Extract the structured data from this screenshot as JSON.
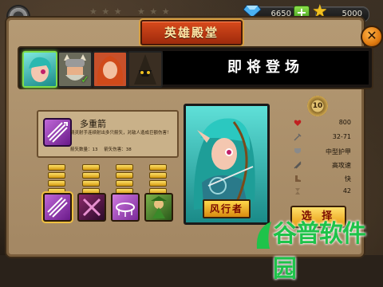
{
  "header": {
    "title": "英雄殿堂",
    "gems": "6650",
    "gold": "5000",
    "stars_left": "★ ★ ★",
    "stars_right": "★ ★ ★"
  },
  "heroes": {
    "coming_soon": "即将登场",
    "portraits": [
      {
        "name": "teal-archer-portrait",
        "color": "#2bb8b0",
        "selected": true
      },
      {
        "name": "viking-portrait",
        "color": "#8a8a7a",
        "checked": true
      },
      {
        "name": "redhead-portrait",
        "color": "#d0582a"
      },
      {
        "name": "dark-mage-portrait",
        "color": "#5a4a3a"
      }
    ]
  },
  "skill": {
    "name": "多重箭",
    "description": "精灵射手连续射出多只箭矢，对敌人造成巨额伤害！",
    "meta": "箭矢数量：13   箭矢伤害：38"
  },
  "hero_card": {
    "name": "风行者"
  },
  "stats": {
    "level": "10",
    "health": "800",
    "damage": "32-71",
    "armor": "中型护甲",
    "attack_speed": "高攻速",
    "move_speed": "快",
    "range": "42"
  },
  "buttons": {
    "select": "选 择"
  },
  "colors": {
    "panel": "#a38763",
    "title_plaque": "#c33a14",
    "accent_gold": "#f0c040",
    "card_teal": "#3cc8c0",
    "watermark_green": "#1ec34a"
  },
  "watermark": "谷普软件园"
}
